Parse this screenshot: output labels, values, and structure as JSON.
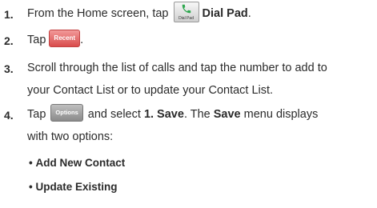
{
  "steps": [
    {
      "num": "1.",
      "pre": "From the Home screen, tap",
      "icon_caption": "Dial Pad",
      "post": "Dial Pad",
      "end": "."
    },
    {
      "num": "2.",
      "pre": "Tap",
      "button": "Recent",
      "end": "."
    },
    {
      "num": "3.",
      "line1": "Scroll through the list of calls and tap the number to add to",
      "line2": "your Contact List or to update your Contact List."
    },
    {
      "num": "4.",
      "pre": "Tap",
      "button": "Options",
      "mid": "and select",
      "bold1": "1. Save",
      "mid2": ". The",
      "bold2": "Save",
      "mid3": "menu displays",
      "line2": "with two options:"
    }
  ],
  "bullets": [
    "Add New Contact",
    "Update Existing"
  ],
  "colors": {
    "recent_button": "#d94c4c",
    "options_button": "#8a8a8a",
    "phone_icon": "#2fa84f"
  },
  "icons": {
    "dial_pad": "phone-handset-icon"
  }
}
